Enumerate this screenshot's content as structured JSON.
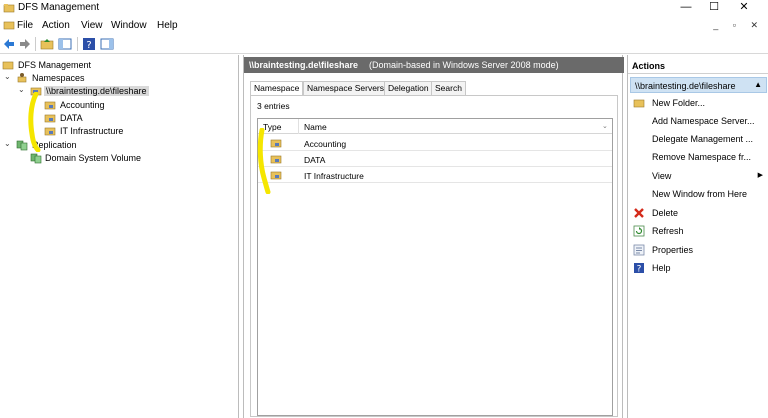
{
  "window": {
    "title": "DFS Management"
  },
  "window_buttons": {
    "minimize": "—",
    "maximize": "☐",
    "close": "✕"
  },
  "menu": {
    "items": [
      "File",
      "Action",
      "View",
      "Window",
      "Help"
    ],
    "mdi_buttons": "_ ▫ ✕"
  },
  "toolbar": {
    "icons": [
      "back-arrow",
      "forward-arrow",
      "up-folder",
      "show-hide-tree",
      "help",
      "show-hide-action-pane"
    ]
  },
  "tree": {
    "root": "DFS Management",
    "namespaces": "Namespaces",
    "namespace_item": "\\\\braintesting.de\\fileshare",
    "folders": [
      "Accounting",
      "DATA",
      "IT Infrastructure"
    ],
    "replication": "Replication",
    "replication_item": "Domain System Volume"
  },
  "center": {
    "header_path": "\\\\braintesting.de\\fileshare",
    "header_desc": "(Domain-based in Windows Server 2008 mode)",
    "tabs": [
      "Namespace",
      "Namespace Servers",
      "Delegation",
      "Search"
    ],
    "active_tab": "Namespace",
    "entries_count": "3 entries",
    "columns": [
      "Type",
      "Name"
    ],
    "rows": [
      "Accounting",
      "DATA",
      "IT Infrastructure"
    ]
  },
  "actions": {
    "title": "Actions",
    "subheader": "\\\\braintesting.de\\fileshare",
    "items": [
      "New Folder...",
      "Add Namespace Server...",
      "Delegate Management ...",
      "Remove Namespace fr...",
      "View",
      "New Window from Here",
      "Delete",
      "Refresh",
      "Properties",
      "Help"
    ]
  },
  "colors": {
    "header_bg": "#6a6a6a",
    "selected_action_bg": "#cfe2f3",
    "highlighter": "#f5e600"
  }
}
